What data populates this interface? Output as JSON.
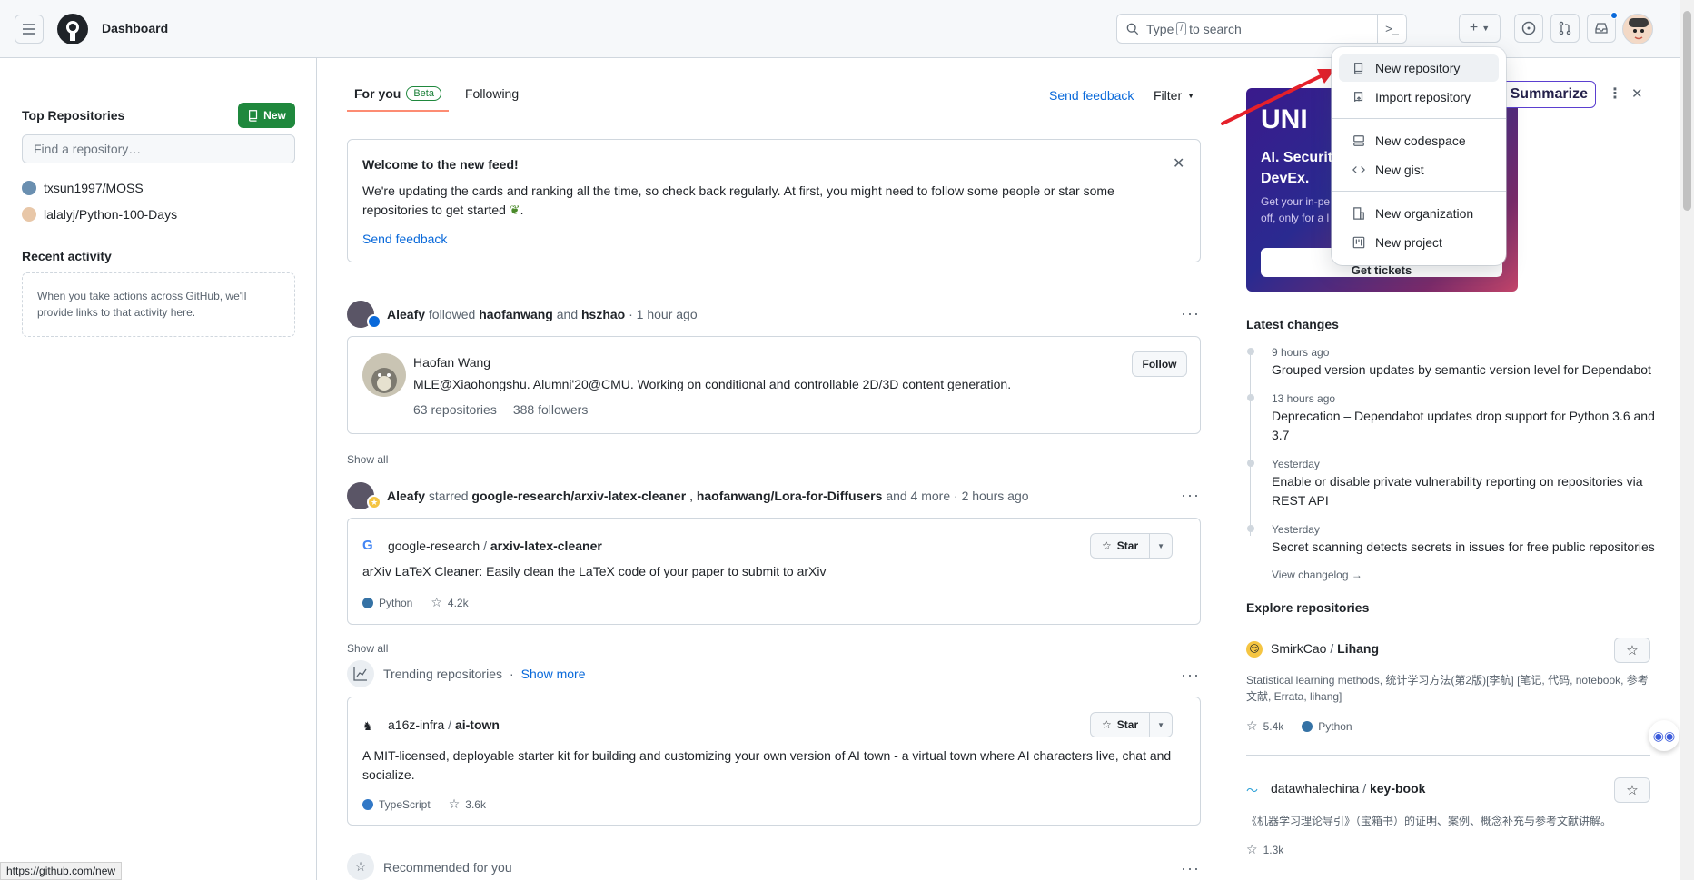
{
  "header": {
    "title": "Dashboard",
    "search": {
      "prefix": "Type",
      "key": "/",
      "suffix": "to search"
    }
  },
  "sidebar": {
    "top_repos_title": "Top Repositories",
    "new_button": "New",
    "find_placeholder": "Find a repository…",
    "repos": [
      "txsun1997/MOSS",
      "lalalyj/Python-100-Days"
    ],
    "recent_title": "Recent activity",
    "recent_empty": "When you take actions across GitHub, we'll provide links to that activity here."
  },
  "feed": {
    "tabs": {
      "for_you": "For you",
      "beta": "Beta",
      "following": "Following"
    },
    "send_feedback": "Send feedback",
    "filter": "Filter",
    "welcome": {
      "title": "Welcome to the new feed!",
      "body": "We're updating the cards and ranking all the time, so check back regularly. At first, you might need to follow some people or star some repositories to get started",
      "link": "Send feedback"
    },
    "event1": {
      "actor": "Aleafy",
      "verb": "followed",
      "user1": "haofanwang",
      "and": "and",
      "user2": "hszhao",
      "time": "· 1 hour ago",
      "card": {
        "name": "Haofan Wang",
        "bio": "MLE@Xiaohongshu. Alumni'20@CMU. Working on conditional and controllable 2D/3D content generation.",
        "repos": "63 repositories",
        "followers": "388 followers",
        "follow": "Follow"
      },
      "show_all": "Show all"
    },
    "event2": {
      "actor": "Aleafy",
      "verb": "starred",
      "repo1": "google-research/arxiv-latex-cleaner",
      "sep": ",",
      "repo2": "haofanwang/Lora-for-Diffusers",
      "more": "and 4 more · 2 hours ago",
      "card": {
        "owner": "google-research",
        "slash": "/",
        "repo": "arxiv-latex-cleaner",
        "desc": "arXiv LaTeX Cleaner: Easily clean the LaTeX code of your paper to submit to arXiv",
        "lang": "Python",
        "stars": "4.2k",
        "star": "Star"
      },
      "show_all": "Show all"
    },
    "trending": {
      "label": "Trending repositories",
      "dot": "·",
      "show_more": "Show more",
      "card": {
        "owner": "a16z-infra",
        "slash": "/",
        "repo": "ai-town",
        "desc": "A MIT-licensed, deployable starter kit for building and customizing your own version of AI town - a virtual town where AI characters live, chat and socialize.",
        "lang": "TypeScript",
        "stars": "3.6k",
        "star": "Star"
      }
    },
    "recommended": "Recommended for you"
  },
  "right": {
    "promo": {
      "brand": "UNI",
      "headline1": "AI. Security",
      "headline2": "DevEx.",
      "body1": "Get your in-pe",
      "body2": "off, only for a l",
      "cta": "Get tickets"
    },
    "summarize": "Summarize",
    "latest_title": "Latest changes",
    "changes": [
      {
        "time": "9 hours ago",
        "text": "Grouped version updates by semantic version level for Dependabot"
      },
      {
        "time": "13 hours ago",
        "text": "Deprecation – Dependabot updates drop support for Python 3.6 and 3.7"
      },
      {
        "time": "Yesterday",
        "text": "Enable or disable private vulnerability reporting on repositories via REST API"
      },
      {
        "time": "Yesterday",
        "text": "Secret scanning detects secrets in issues for free public repositories"
      }
    ],
    "changelog": "View changelog →",
    "explore_title": "Explore repositories",
    "explore": [
      {
        "owner": "SmirkCao",
        "slash": "/",
        "repo": "Lihang",
        "desc": "Statistical learning methods, 统计学习方法(第2版)[李航] [笔记, 代码, notebook, 参考文献, Errata, lihang]",
        "stars": "5.4k",
        "lang": "Python"
      },
      {
        "owner": "datawhalechina",
        "slash": "/",
        "repo": "key-book",
        "desc": "《机器学习理论导引》（宝箱书）的证明、案例、概念补充与参考文献讲解。",
        "stars": "1.3k"
      }
    ]
  },
  "dropdown": {
    "items": [
      "New repository",
      "Import repository",
      "New codespace",
      "New gist",
      "New organization",
      "New project"
    ]
  },
  "status_url": "https://github.com/new",
  "colors": {
    "green": "#1f883d",
    "link": "#0969da",
    "accent_orange": "#fd8c73",
    "python": "#3572A5",
    "typescript": "#3178c6",
    "annotation_red": "#e5202a"
  }
}
